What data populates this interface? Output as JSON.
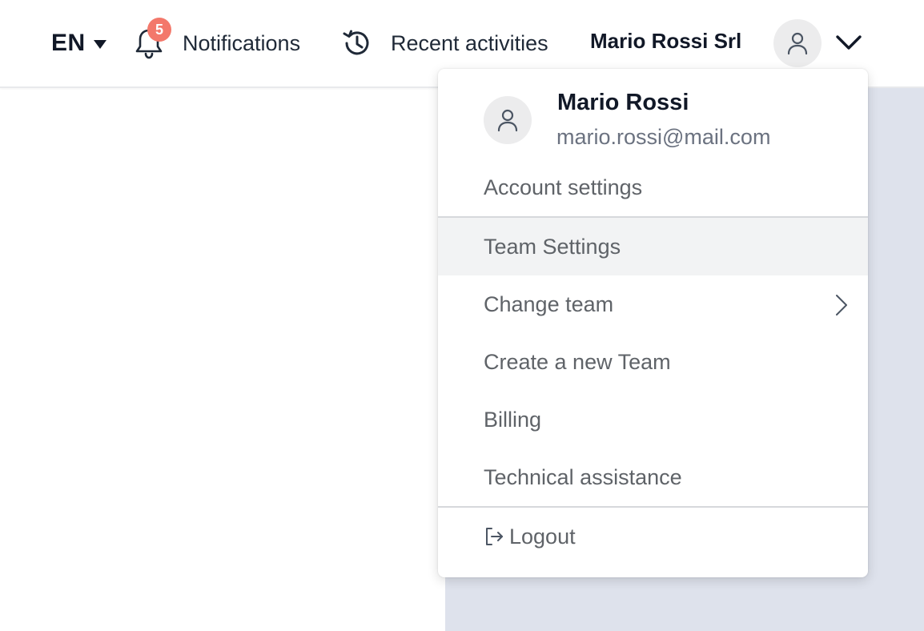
{
  "header": {
    "language": "EN",
    "notifications_label": "Notifications",
    "notifications_count": "5",
    "recent_label": "Recent activities",
    "company": "Mario Rossi Srl"
  },
  "user_menu": {
    "name": "Mario Rossi",
    "email": "mario.rossi@mail.com",
    "items": [
      {
        "label": "Account settings"
      },
      {
        "label": "Team Settings"
      },
      {
        "label": "Change team"
      },
      {
        "label": "Create a new Team"
      },
      {
        "label": "Billing"
      },
      {
        "label": "Technical assistance"
      }
    ],
    "logout_label": "Logout"
  },
  "colors": {
    "badge": "#f3786b",
    "hover_bg": "#f2f3f4",
    "panel_bg": "#dee2ec"
  },
  "icons": [
    "caret-down-icon",
    "bell-icon",
    "history-icon",
    "user-icon",
    "chevron-down-icon",
    "chevron-right-icon",
    "logout-icon"
  ]
}
